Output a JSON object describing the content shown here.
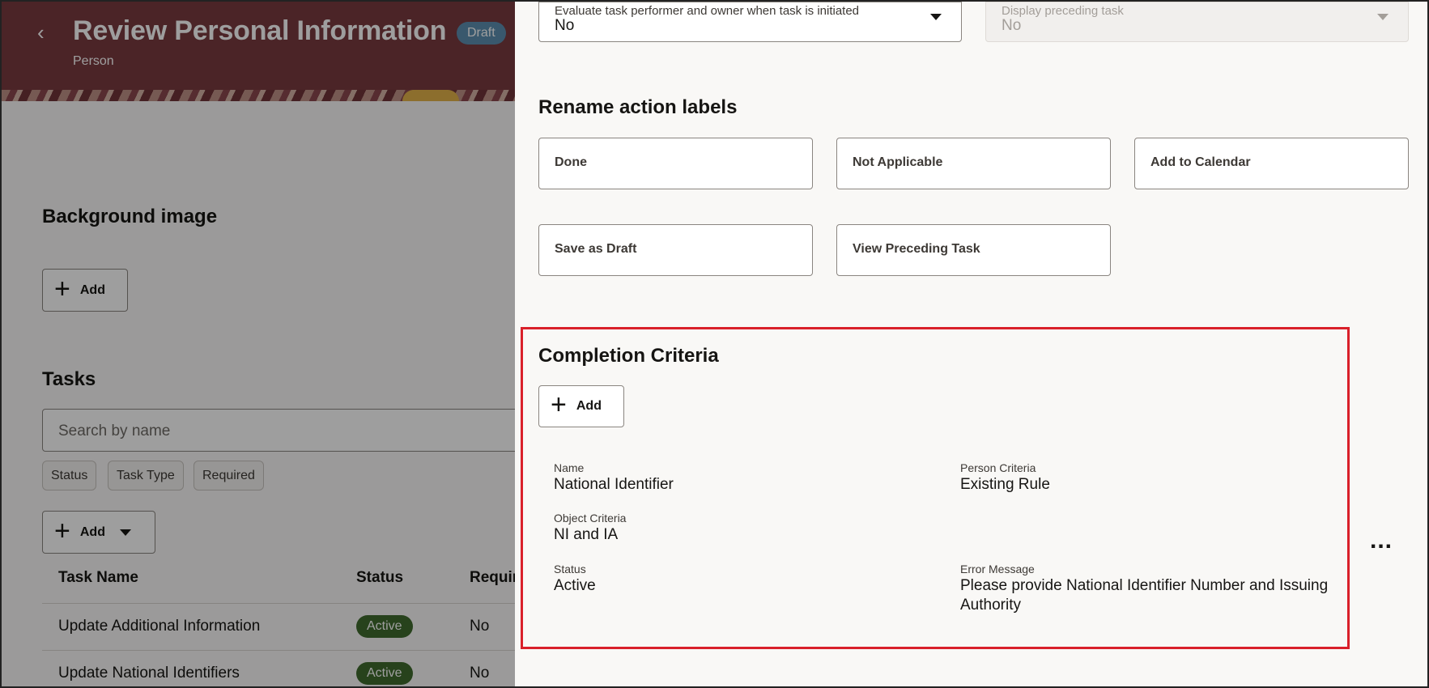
{
  "page": {
    "title": "Review Personal Information",
    "badge": "Draft",
    "subtitle": "Person"
  },
  "background_section": {
    "title": "Background image",
    "add_label": "Add"
  },
  "tasks_section": {
    "title": "Tasks",
    "search_placeholder": "Search by name",
    "filters": [
      "Status",
      "Task Type",
      "Required"
    ],
    "add_label": "Add",
    "columns": [
      "Task Name",
      "Status",
      "Requir"
    ],
    "rows": [
      {
        "name": "Update Additional Information",
        "status": "Active",
        "required": "No"
      },
      {
        "name": "Update National Identifiers",
        "status": "Active",
        "required": "No"
      }
    ]
  },
  "drawer": {
    "evaluate_field": {
      "label": "Evaluate task performer and owner when task is initiated",
      "value": "No"
    },
    "preceding_field": {
      "label": "Display preceding task",
      "value": "No"
    },
    "rename_section": {
      "title": "Rename action labels",
      "labels": [
        "Done",
        "Not Applicable",
        "Add to Calendar",
        "Save as Draft",
        "View Preceding Task"
      ]
    },
    "completion_criteria": {
      "title": "Completion Criteria",
      "add_label": "Add",
      "name_label": "Name",
      "name_value": "National Identifier",
      "person_criteria_label": "Person Criteria",
      "person_criteria_value": "Existing Rule",
      "object_criteria_label": "Object Criteria",
      "object_criteria_value": "NI and IA",
      "status_label": "Status",
      "status_value": "Active",
      "error_label": "Error Message",
      "error_value": "Please provide National Identifier Number and Issuing Authority",
      "more_label": "..."
    }
  },
  "colors": {
    "hero": "#7a3a40",
    "active_badge": "#3f6b2e",
    "draft_badge": "#5c8fb0",
    "highlight": "#d9202a"
  }
}
